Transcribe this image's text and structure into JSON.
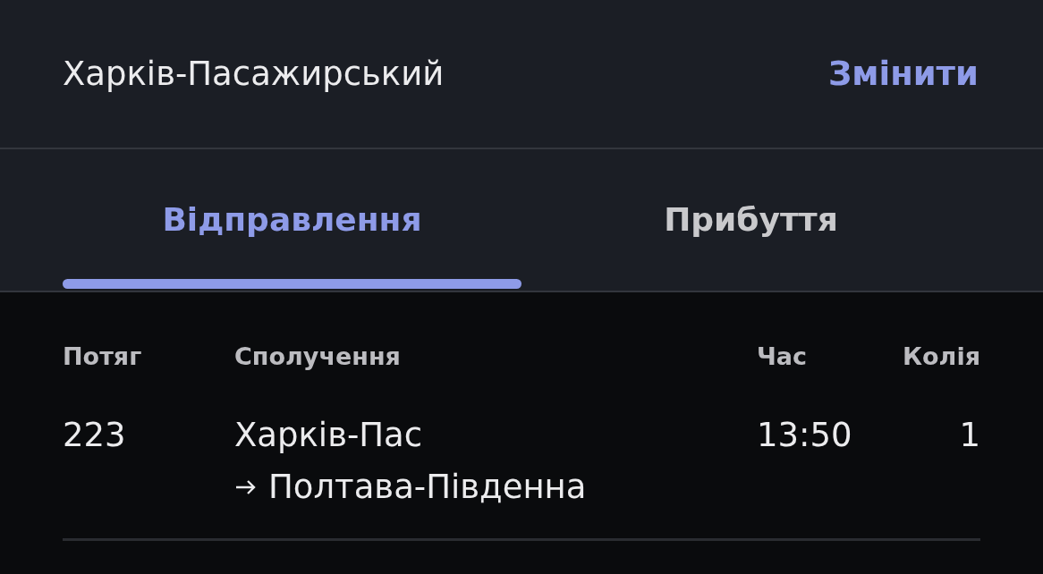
{
  "header": {
    "station": "Харків-Пасажирський",
    "change_link": "Змінити"
  },
  "tabs": [
    {
      "label": "Відправлення",
      "selected": true
    },
    {
      "label": "Прибуття",
      "selected": false
    }
  ],
  "table": {
    "columns": [
      "Потяг",
      "Сполучення",
      "Час",
      "Колія"
    ],
    "rows": [
      {
        "train": "223",
        "from": "Харків-Пас",
        "to": "Полтава-Південна",
        "time": "13:50",
        "track": "1"
      }
    ]
  }
}
